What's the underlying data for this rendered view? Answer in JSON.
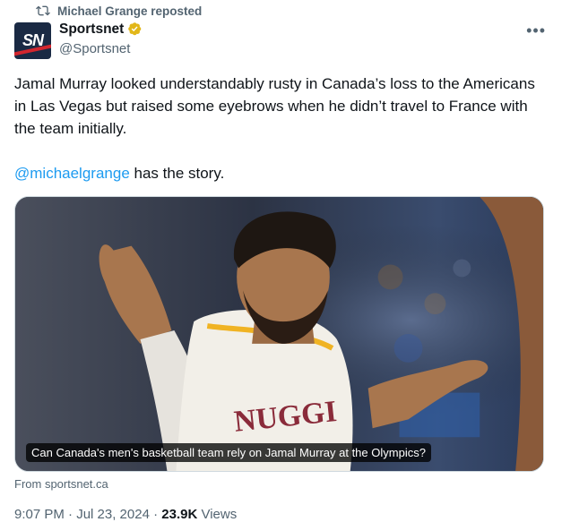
{
  "repost": {
    "icon": "repost-icon",
    "label": "Michael Grange reposted"
  },
  "author": {
    "avatar_text": "SN",
    "name": "Sportsnet",
    "handle": "@Sportsnet",
    "verified_color": "#e2b719"
  },
  "tweet": {
    "text_line": "Jamal Murray looked understandably rusty in Canada’s loss to the Americans in Las Vegas but raised some eyebrows when he didn’t travel to France with the team initially.",
    "mention": "@michaelgrange",
    "text_after_mention": " has the story."
  },
  "card": {
    "caption": "Can Canada's men's basketball team rely on Jamal Murray at the Olympics?",
    "source": "From sportsnet.ca"
  },
  "meta": {
    "time": "9:07 PM · Jul 23, 2024 · ",
    "views_count": "23.9K",
    "views_label": " Views"
  },
  "colors": {
    "accent": "#1d9bf0",
    "secondary_text": "#536471"
  }
}
